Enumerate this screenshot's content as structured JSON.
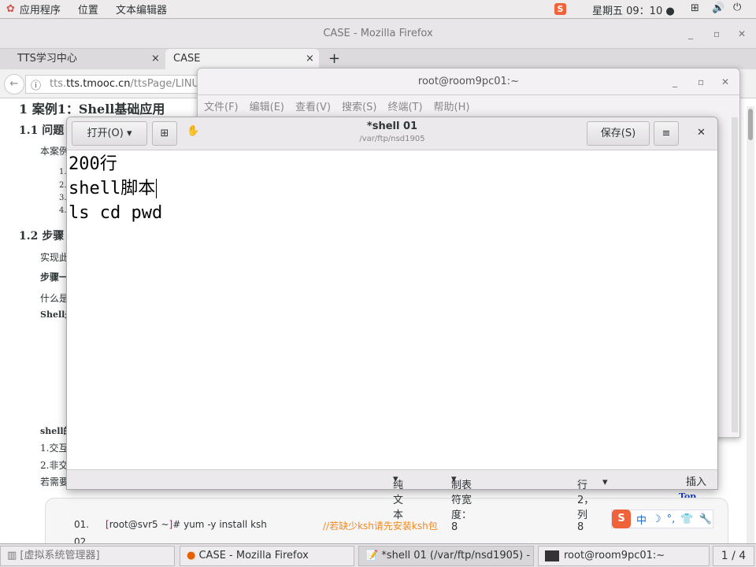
{
  "topbar": {
    "apps": "应用程序",
    "places": "位置",
    "app_name": "文本编辑器",
    "clock": "星期五 09：10 ●",
    "icons": [
      "sogou-icon",
      "network-icon",
      "volume-icon",
      "power-icon"
    ]
  },
  "firefox": {
    "title": "CASE - Mozilla Firefox",
    "tabs": [
      {
        "label": "TTS学习中心"
      },
      {
        "label": "CASE"
      }
    ],
    "url_domain": "tts.tmooc.cn",
    "url_pre": "tts.",
    "url_rest": "/ttsPage/LINUX/NS"
  },
  "page": {
    "h1": "1 案例1：Shell基础应用",
    "h11": "1.1 问题",
    "p1": "本案例",
    "li": [
      "1.",
      "2.",
      "3.",
      "4."
    ],
    "h12": "1.2 步骤",
    "s1": "实现此",
    "s2": "步骤一",
    "s3": "什么是",
    "s4": "Shell是",
    "s5": "shell的",
    "s6": "1.交互",
    "s7": "2.非交",
    "s8": "若需要",
    "top": "Top"
  },
  "code": {
    "line_no": "01.",
    "prompt_open": "[",
    "prompt": "root@svr5 ~",
    "prompt_close": "]",
    "cmd": "# yum -y install ksh",
    "comment": "//若缺少ksh请先安装ksh包",
    "line2": "02."
  },
  "terminal": {
    "title": "root@room9pc01:~",
    "menu": [
      "文件(F)",
      "编辑(E)",
      "查看(V)",
      "搜索(S)",
      "终端(T)",
      "帮助(H)"
    ]
  },
  "gedit": {
    "open": "打开(O)",
    "title": "*shell 01",
    "path": "/var/ftp/nsd1905",
    "save": "保存(S)",
    "lines": [
      "200行",
      "shell脚本",
      "ls cd pwd"
    ],
    "status": {
      "lang": "纯文本",
      "tab": "制表符宽度：8",
      "pos": "行 2，列 8",
      "mode": "插入"
    }
  },
  "sogou": {
    "items": [
      "中",
      "☽",
      "°,",
      "👕",
      "🔧"
    ]
  },
  "taskbar": {
    "items": [
      "[虚拟系统管理器]",
      "CASE - Mozilla Firefox",
      "*shell 01 (/var/ftp/nsd1905) - ···",
      "root@room9pc01:~"
    ],
    "workspace": "1 / 4"
  }
}
